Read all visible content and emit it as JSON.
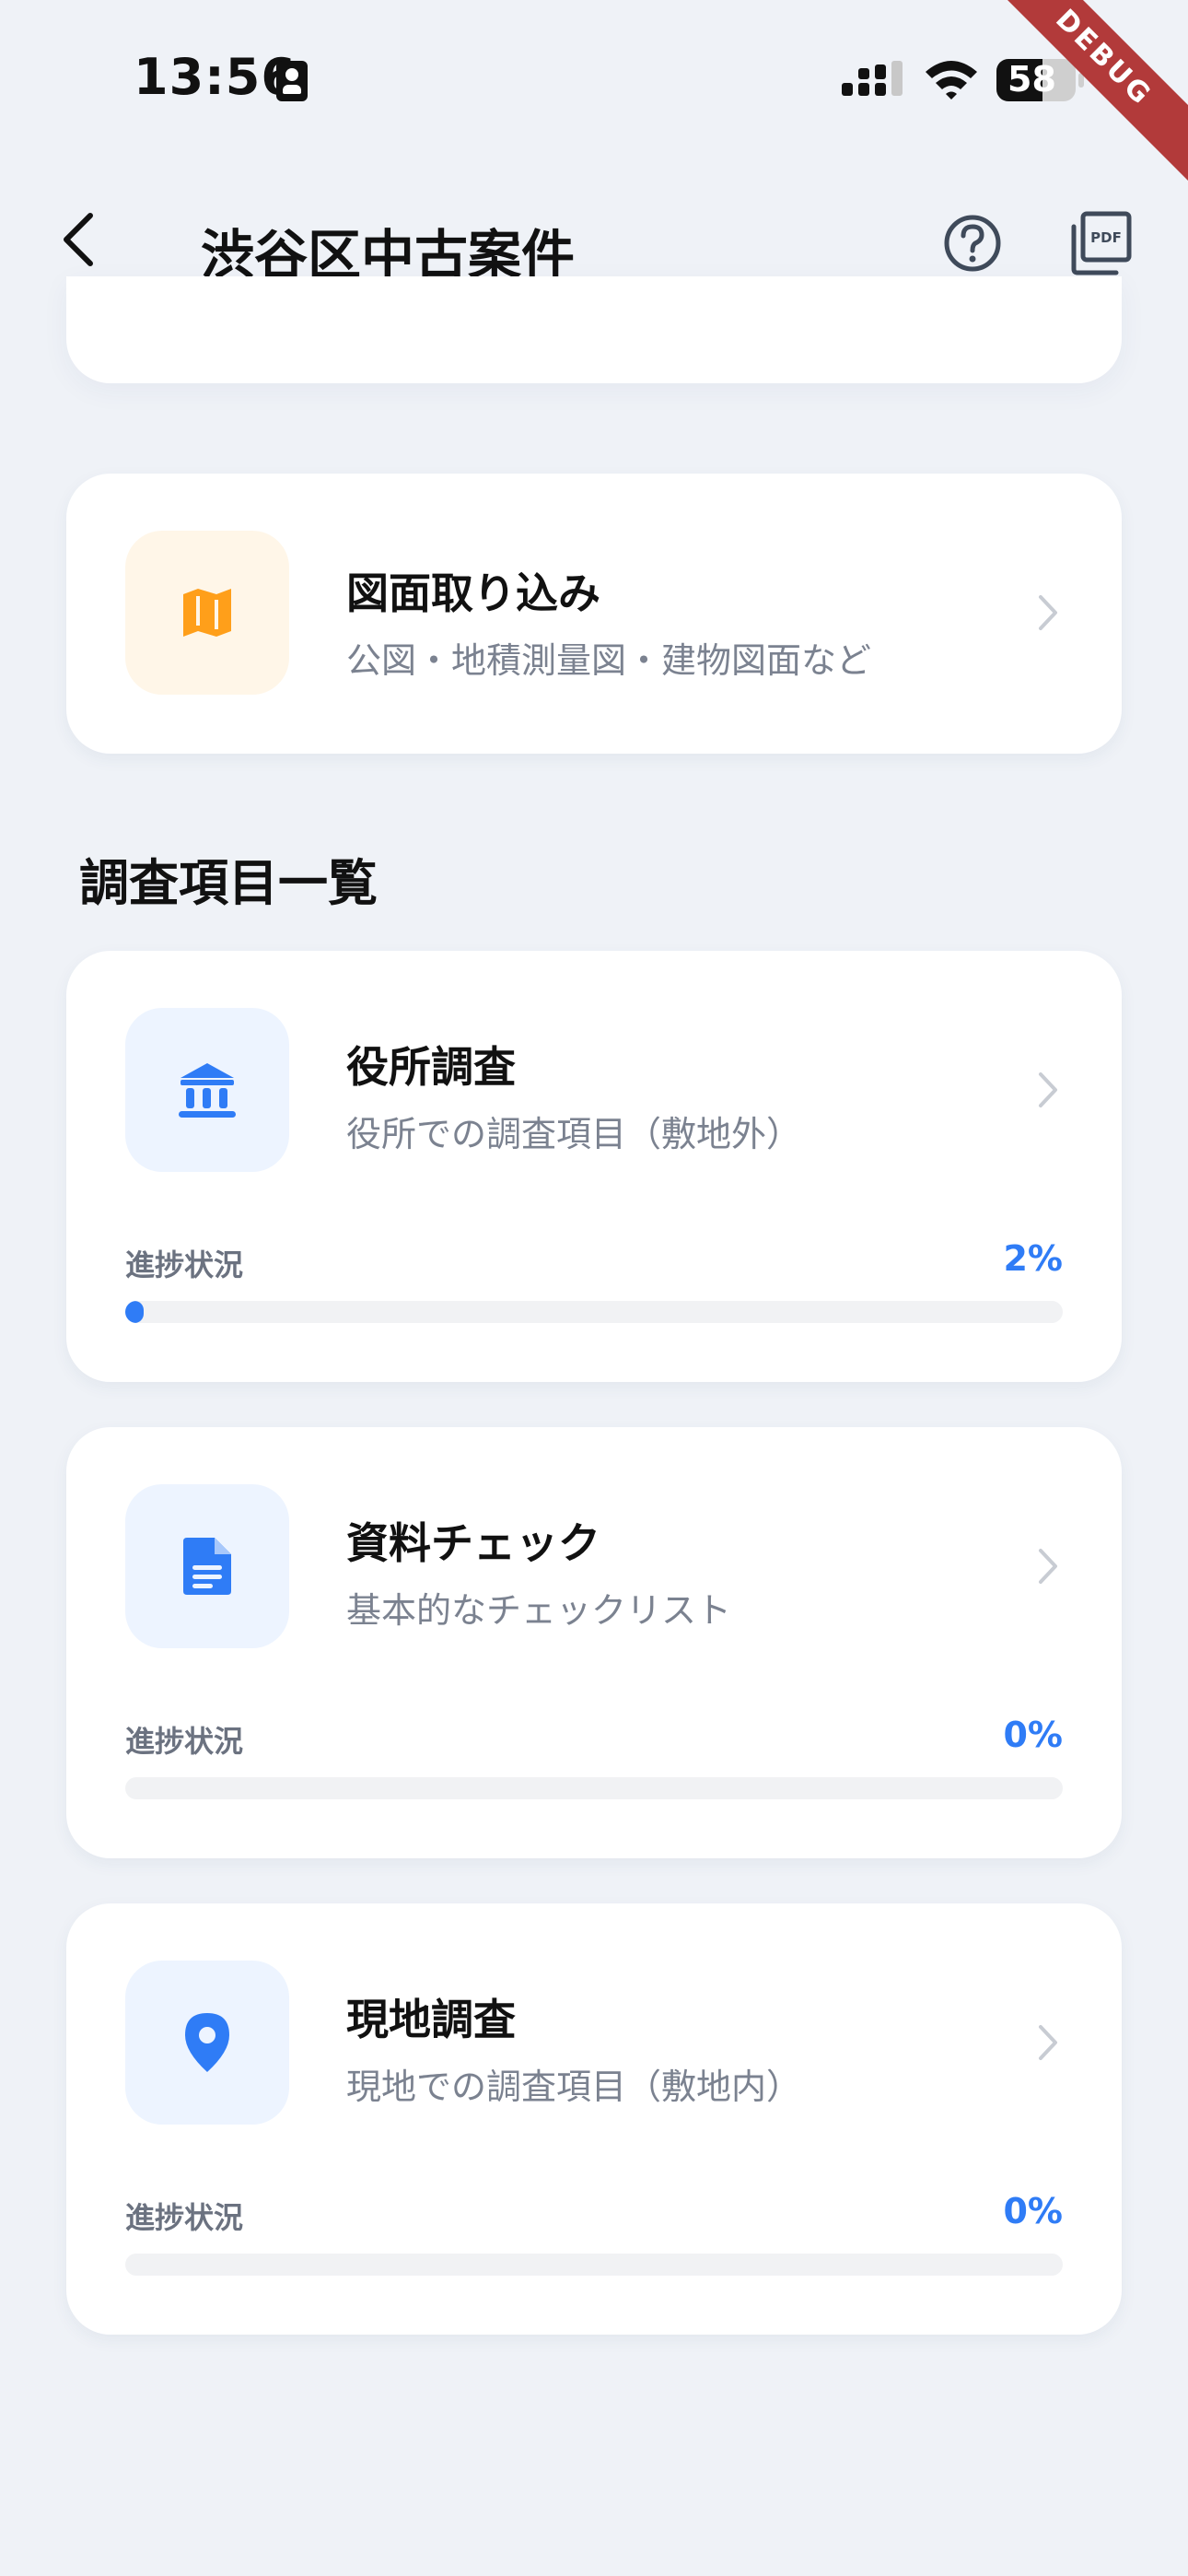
{
  "status_bar": {
    "time": "13:56",
    "battery": "58"
  },
  "debug_banner": "DEBUG",
  "app_bar": {
    "title": "渋谷区中古案件"
  },
  "import_card": {
    "title": "図面取り込み",
    "subtitle": "公図・地積測量図・建物図面など",
    "icon": "map-icon",
    "icon_color": "#ff9f1a",
    "icon_bg": "#fff6e8"
  },
  "section": {
    "title": "調査項目一覧"
  },
  "items": [
    {
      "title": "役所調査",
      "subtitle": "役所での調査項目（敷地外）",
      "progress_label": "進捗状況",
      "progress_text": "2%",
      "progress": 0.02,
      "icon": "bank-icon"
    },
    {
      "title": "資料チェック",
      "subtitle": "基本的なチェックリスト",
      "progress_label": "進捗状況",
      "progress_text": "0%",
      "progress": 0,
      "icon": "document-icon"
    },
    {
      "title": "現地調査",
      "subtitle": "現地での調査項目（敷地内）",
      "progress_label": "進捗状況",
      "progress_text": "0%",
      "progress": 0,
      "icon": "location-pin-icon"
    }
  ],
  "colors": {
    "accent": "#2f7cf6",
    "icon_bg_blue": "#edf4ff",
    "background": "#eff2f7"
  }
}
